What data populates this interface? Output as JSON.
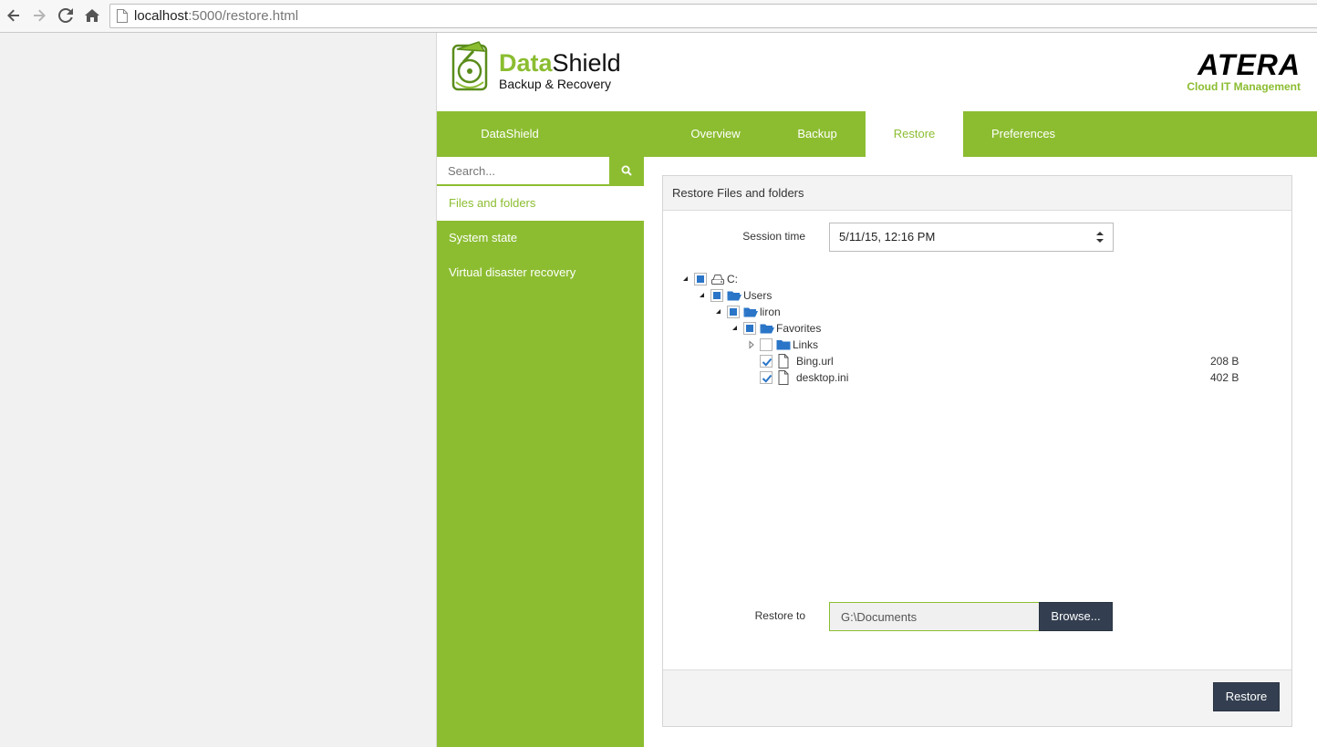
{
  "browser": {
    "url_host": "localhost",
    "url_path": ":5000/restore.html"
  },
  "brand": {
    "name_part1": "Data",
    "name_part2": "Shield",
    "tagline": "Backup & Recovery",
    "color": "#8cbd31"
  },
  "partner": {
    "name": "ATERA",
    "tagline": "Cloud IT Management"
  },
  "nav": {
    "brand_label": "DataShield",
    "tabs": [
      {
        "label": "Overview",
        "active": false
      },
      {
        "label": "Backup",
        "active": false
      },
      {
        "label": "Restore",
        "active": true
      },
      {
        "label": "Preferences",
        "active": false
      }
    ]
  },
  "sidebar": {
    "search_placeholder": "Search...",
    "items": [
      {
        "label": "Files and folders",
        "active": true
      },
      {
        "label": "System state",
        "active": false
      },
      {
        "label": "Virtual disaster recovery",
        "active": false
      }
    ]
  },
  "panel": {
    "title": "Restore Files and folders",
    "session_label": "Session time",
    "session_value": "5/11/15, 12:16 PM",
    "restore_to_label": "Restore to",
    "restore_to_value": "G:\\Documents",
    "browse_label": "Browse...",
    "restore_label": "Restore"
  },
  "tree": [
    {
      "label": "C:",
      "icon": "drive-icon",
      "state": "partial",
      "expanded": true,
      "depth": 0,
      "size": ""
    },
    {
      "label": "Users",
      "icon": "folder-open-icon",
      "state": "partial",
      "expanded": true,
      "depth": 1,
      "size": ""
    },
    {
      "label": "liron",
      "icon": "folder-open-icon",
      "state": "partial",
      "expanded": true,
      "depth": 2,
      "size": ""
    },
    {
      "label": "Favorites",
      "icon": "folder-open-icon",
      "state": "partial",
      "expanded": true,
      "depth": 3,
      "size": ""
    },
    {
      "label": "Links",
      "icon": "folder-icon",
      "state": "unchecked",
      "expanded": false,
      "depth": 4,
      "size": ""
    },
    {
      "label": "Bing.url",
      "icon": "file-icon",
      "state": "checked",
      "expanded": null,
      "depth": 4,
      "size": "208 B"
    },
    {
      "label": "desktop.ini",
      "icon": "file-icon",
      "state": "checked",
      "expanded": null,
      "depth": 4,
      "size": "402 B"
    }
  ]
}
